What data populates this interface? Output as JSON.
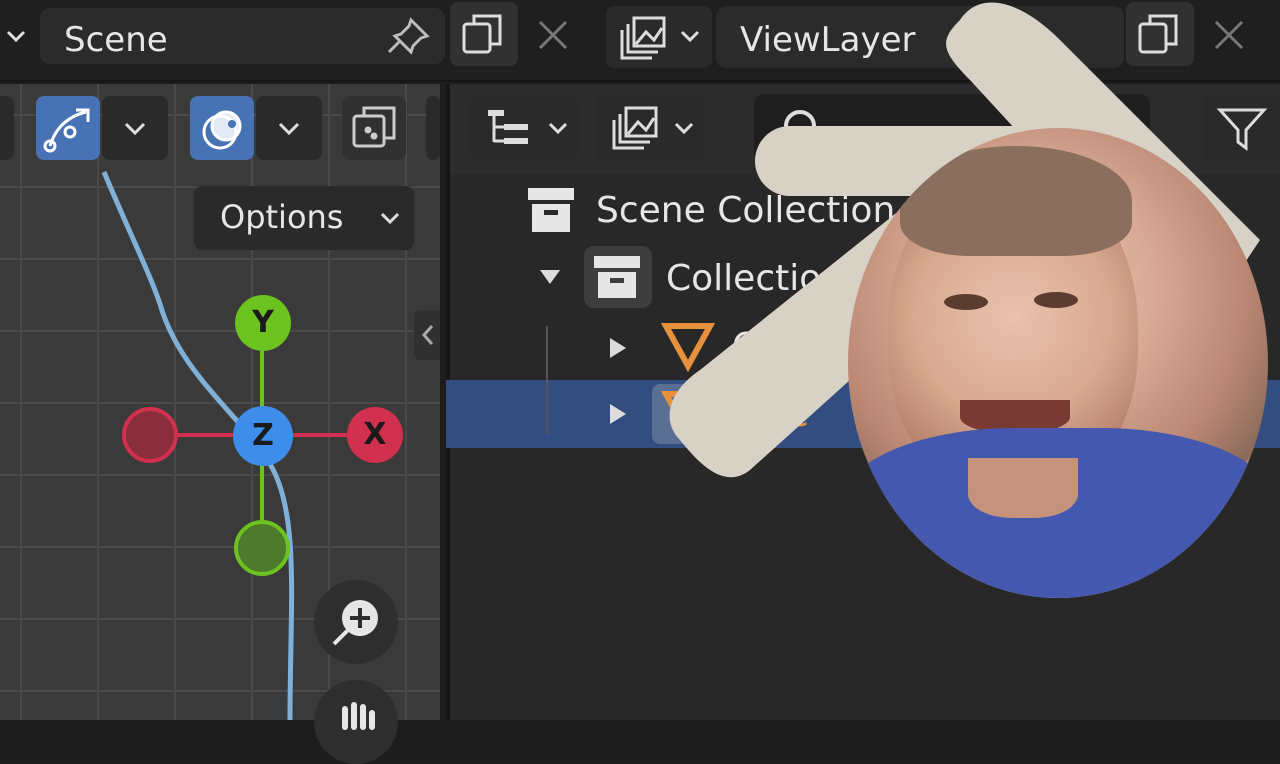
{
  "top_bar": {
    "scene_label": "Scene",
    "view_layer_label": "ViewLayer"
  },
  "viewport": {
    "options_label": "Options",
    "gizmo": {
      "y": "Y",
      "z": "Z",
      "x": "X"
    }
  },
  "outliner": {
    "rows": [
      {
        "label": "Scene Collection"
      },
      {
        "label": "Collection"
      },
      {
        "label": "C"
      },
      {
        "label": "be"
      }
    ]
  },
  "colors": {
    "accent_blue": "#4772b3",
    "selected_row": "#334d80",
    "gizmo_x": "#d2304f",
    "gizmo_y": "#6cc21f",
    "gizmo_z": "#3e8dea",
    "mesh_orange": "#e8913c"
  }
}
